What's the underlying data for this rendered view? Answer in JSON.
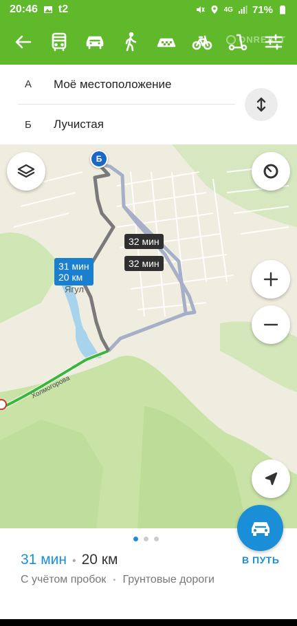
{
  "status_bar": {
    "time": "20:46",
    "carrier": "t2",
    "network": "4G",
    "battery": "71%"
  },
  "toolbar": {
    "back_icon": "arrow-left-icon",
    "modes": [
      {
        "name": "bus",
        "icon": "bus-icon"
      },
      {
        "name": "car",
        "icon": "car-icon"
      },
      {
        "name": "walk",
        "icon": "walk-icon"
      },
      {
        "name": "taxi",
        "icon": "taxi-icon"
      },
      {
        "name": "bike",
        "icon": "bike-icon"
      },
      {
        "name": "scooter",
        "icon": "scooter-icon"
      }
    ],
    "settings_icon": "sliders-icon",
    "watermark": "ONREALT"
  },
  "route": {
    "from_letter": "А",
    "from_text": "Моё местоположение",
    "to_letter": "Б",
    "to_text": "Лучистая"
  },
  "map": {
    "marker_letter": "Б",
    "alt_time_1": "32 мин",
    "alt_time_2": "32 мин",
    "selected_time": "31 мин",
    "selected_distance": "20 км",
    "place_label": "Ягул",
    "street_label": "Холмогорова"
  },
  "sheet": {
    "time": "31 мин",
    "separator": "•",
    "distance": "20 км",
    "note_1": "С учётом пробок",
    "note_separator": "•",
    "note_2": "Грунтовые дороги",
    "go_label": "В ПУТЬ",
    "page_count": 3,
    "active_page": 1
  },
  "colors": {
    "toolbar_green": "#5fb92a",
    "accent_blue": "#1a8fd8",
    "route_gray": "#7a7a7a",
    "route_alt": "#a7aec7",
    "route_traffic_green": "#3bb53a"
  }
}
